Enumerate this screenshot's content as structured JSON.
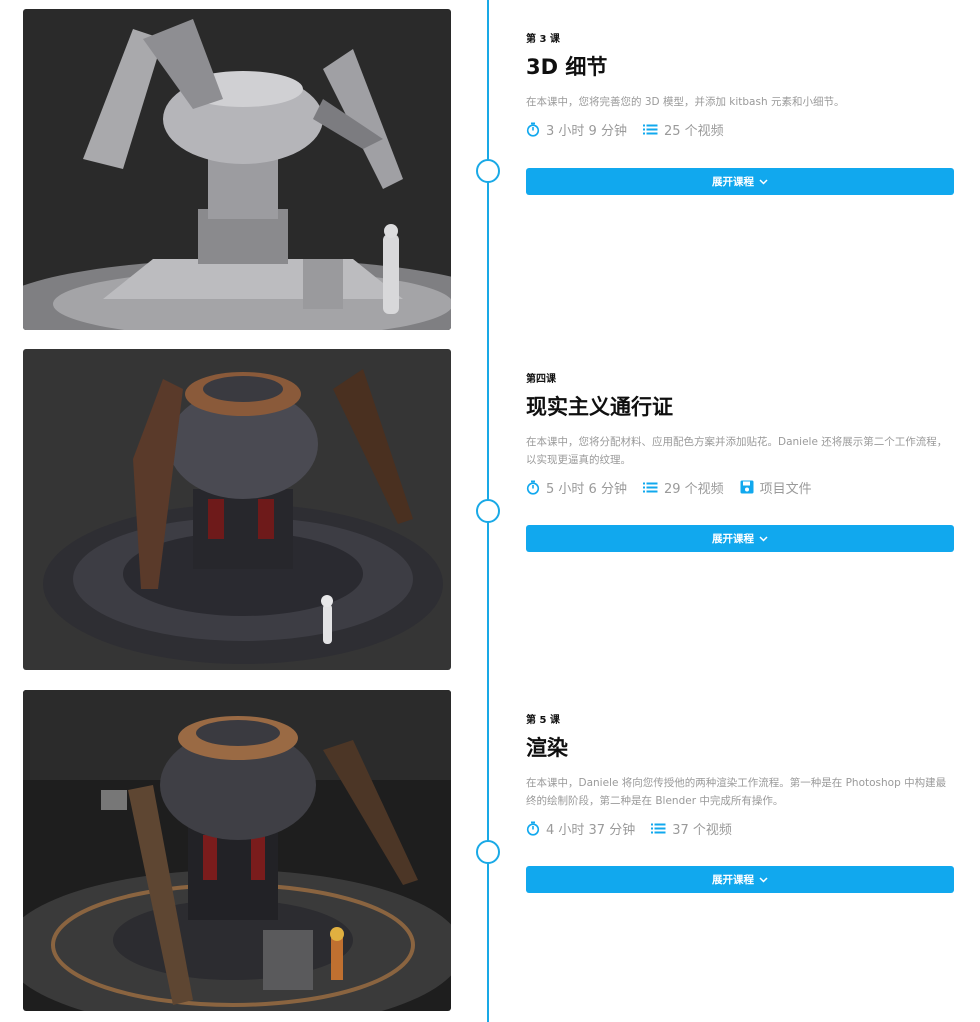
{
  "lessons": [
    {
      "kicker": "第 3 课",
      "title": "3D 细节",
      "description": "在本课中，您将完善您的 3D 模型，并添加 kitbash 元素和小细节。",
      "duration": "3 小时 9 分钟",
      "videos": "25 个视频",
      "expand_label": "展开课程"
    },
    {
      "kicker": "第四课",
      "title": "现实主义通行证",
      "description": "在本课中，您将分配材料、应用配色方案并添加贴花。Daniele 还将展示第二个工作流程，以实现更逼真的纹理。",
      "duration": "5 小时 6 分钟",
      "videos": "29 个视频",
      "project_files": "项目文件",
      "expand_label": "展开课程"
    },
    {
      "kicker": "第 5 课",
      "title": "渲染",
      "description": "在本课中，Daniele 将向您传授他的两种渲染工作流程。第一种是在 Photoshop 中构建最终的绘制阶段，第二种是在 Blender 中完成所有操作。",
      "duration": "4 小时 37 分钟",
      "videos": "37 个视频",
      "expand_label": "展开课程"
    }
  ],
  "colors": {
    "accent": "#11a8ee",
    "timeline": "#19a9e6",
    "muted_text": "#9a9a9a"
  }
}
